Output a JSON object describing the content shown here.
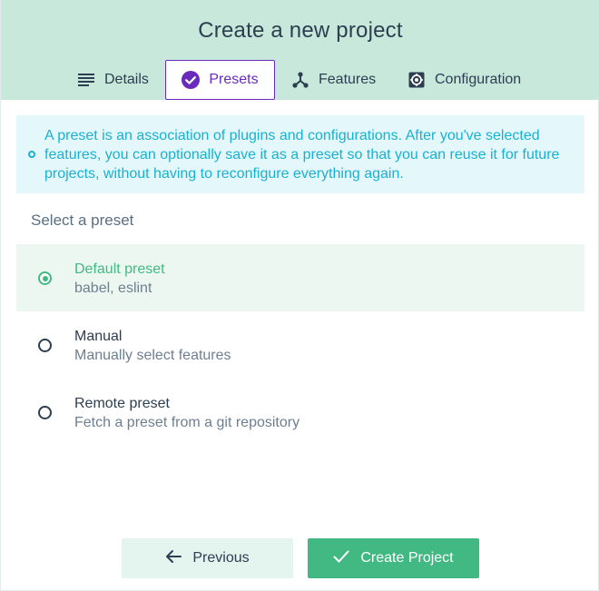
{
  "header": {
    "title": "Create a new project"
  },
  "tabs": [
    {
      "label": "Details",
      "icon": "list-icon",
      "active": false
    },
    {
      "label": "Presets",
      "icon": "check-circle-icon",
      "active": true
    },
    {
      "label": "Features",
      "icon": "branch-icon",
      "active": false
    },
    {
      "label": "Configuration",
      "icon": "settings-icon",
      "active": false
    }
  ],
  "info": {
    "text": "A preset is an association of plugins and configurations. After you've selected features, you can optionally save it as a preset so that you can reuse it for future projects, without having to reconfigure everything again."
  },
  "presets": {
    "section_title": "Select a preset",
    "items": [
      {
        "name": "Default preset",
        "description": "babel, eslint",
        "selected": true
      },
      {
        "name": "Manual",
        "description": "Manually select features",
        "selected": false
      },
      {
        "name": "Remote preset",
        "description": "Fetch a preset from a git repository",
        "selected": false
      }
    ]
  },
  "footer": {
    "previous_label": "Previous",
    "create_label": "Create Project"
  },
  "colors": {
    "header_bg": "#c7e8da",
    "accent_purple": "#6a2bbd",
    "accent_green": "#42b983",
    "info_blue": "#19b1d0"
  }
}
